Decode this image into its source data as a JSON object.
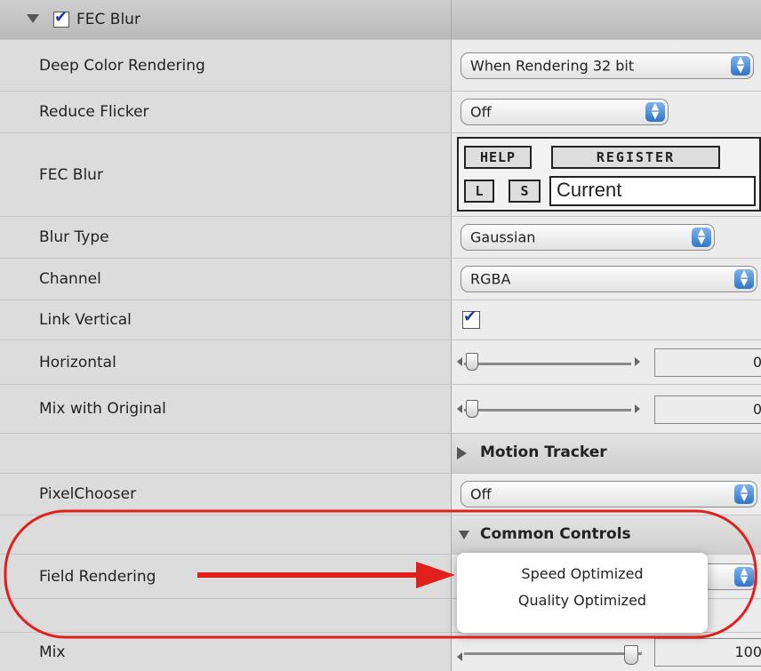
{
  "header": {
    "title": "FEC Blur",
    "enabled": true
  },
  "rows": {
    "deep_color": {
      "label": "Deep Color Rendering",
      "value": "When Rendering 32 bit"
    },
    "reduce_flicker": {
      "label": "Reduce Flicker",
      "value": "Off"
    },
    "fec_blur": {
      "label": "FEC Blur",
      "help": "HELP",
      "register": "REGISTER",
      "l": "L",
      "s": "S",
      "preset": "Current"
    },
    "blur_type": {
      "label": "Blur Type",
      "value": "Gaussian"
    },
    "channel": {
      "label": "Channel",
      "value": "RGBA"
    },
    "link_vertical": {
      "label": "Link Vertical",
      "checked": true
    },
    "horizontal": {
      "label": "Horizontal",
      "value": "0",
      "slider_fraction": 0
    },
    "mix_original": {
      "label": "Mix with Original",
      "value": "0",
      "slider_fraction": 0
    },
    "motion_tracker": {
      "label": "Motion Tracker"
    },
    "pixelchooser": {
      "label": "PixelChooser",
      "value": "Off"
    },
    "common_controls": {
      "label": "Common Controls"
    },
    "field_rendering": {
      "label": "Field Rendering"
    },
    "mix": {
      "label": "Mix",
      "value": "100",
      "slider_fraction": 1
    }
  },
  "popup_menu": {
    "options": [
      "Speed Optimized",
      "Quality Optimized"
    ]
  },
  "annotation": {
    "color": "#e0201c"
  },
  "icons": {
    "disclosure_open": "triangle-down-icon",
    "disclosure_closed": "triangle-right-icon",
    "checkbox": "checkmark-icon",
    "select_arrows": "updown-arrows-icon"
  }
}
